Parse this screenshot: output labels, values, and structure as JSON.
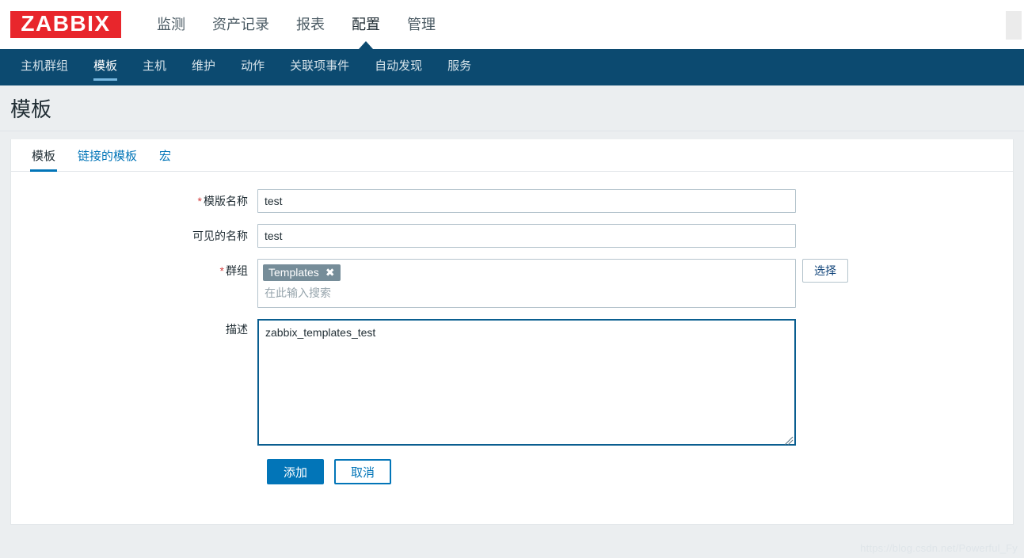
{
  "header": {
    "logo_text": "ZABBIX",
    "menu": [
      {
        "label": "监测",
        "selected": false
      },
      {
        "label": "资产记录",
        "selected": false
      },
      {
        "label": "报表",
        "selected": false
      },
      {
        "label": "配置",
        "selected": true
      },
      {
        "label": "管理",
        "selected": false
      }
    ]
  },
  "subnav": {
    "items": [
      {
        "label": "主机群组",
        "selected": false
      },
      {
        "label": "模板",
        "selected": true
      },
      {
        "label": "主机",
        "selected": false
      },
      {
        "label": "维护",
        "selected": false
      },
      {
        "label": "动作",
        "selected": false
      },
      {
        "label": "关联项事件",
        "selected": false
      },
      {
        "label": "自动发现",
        "selected": false
      },
      {
        "label": "服务",
        "selected": false
      }
    ]
  },
  "page": {
    "title": "模板"
  },
  "tabs": [
    {
      "label": "模板",
      "selected": true
    },
    {
      "label": "链接的模板",
      "selected": false
    },
    {
      "label": "宏",
      "selected": false
    }
  ],
  "form": {
    "template_name": {
      "label": "模版名称",
      "required_marker": "*",
      "value": "test"
    },
    "visible_name": {
      "label": "可见的名称",
      "required_marker": "",
      "value": "test"
    },
    "groups": {
      "label": "群组",
      "required_marker": "*",
      "chips": [
        {
          "label": "Templates",
          "remove_icon": "✖"
        }
      ],
      "placeholder": "在此输入搜索",
      "value": "",
      "select_button": "选择"
    },
    "description": {
      "label": "描述",
      "required_marker": "",
      "value": "zabbix_templates_test"
    },
    "actions": {
      "submit": "添加",
      "cancel": "取消"
    }
  },
  "watermark": "https://blog.csdn.net/Powerful_Fy",
  "colors": {
    "brand_red": "#e8262c",
    "nav_blue": "#0c4a70",
    "accent_blue": "#0275b8",
    "chip_gray": "#768d99",
    "required_red": "#d23c3c",
    "page_bg": "#ebeef0"
  }
}
